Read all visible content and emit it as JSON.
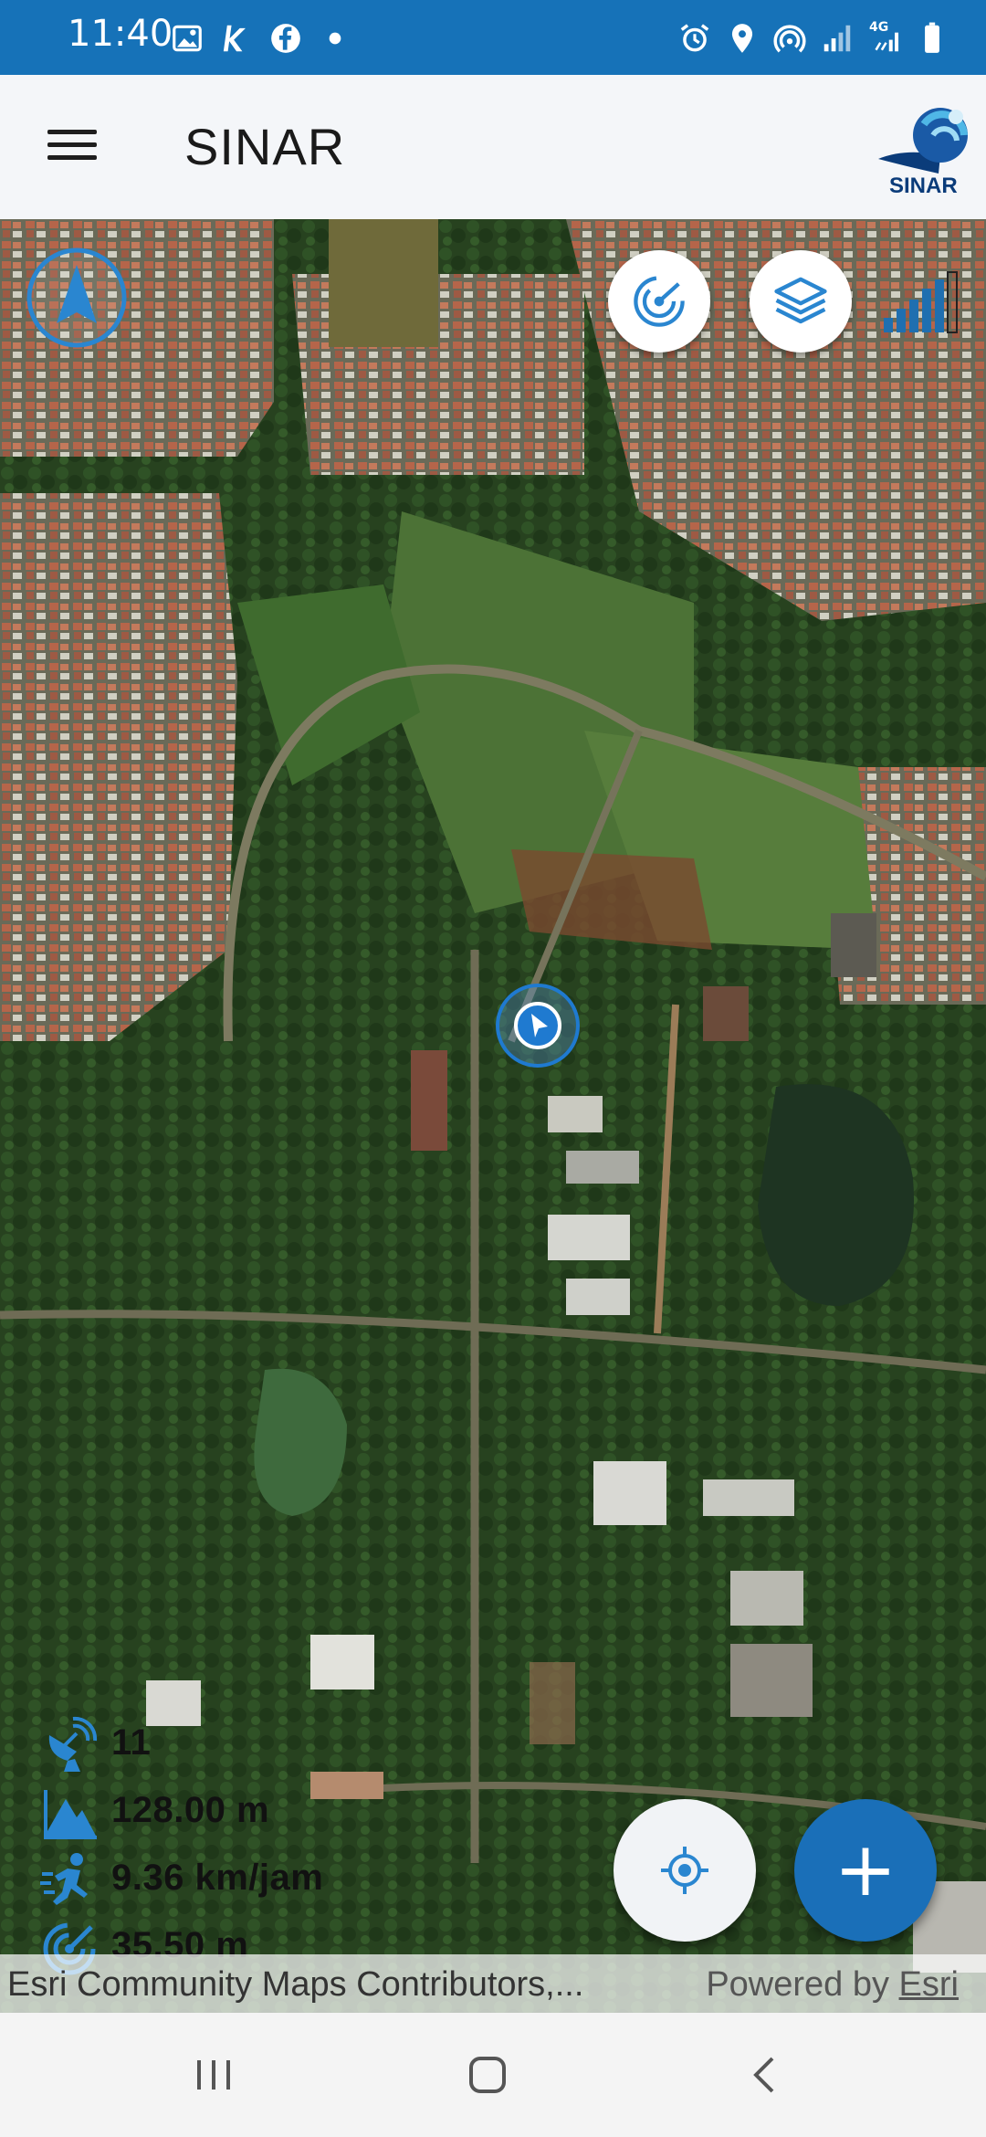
{
  "status_bar": {
    "time": "11:40",
    "left_icons": [
      "image-icon",
      "k-app-icon",
      "facebook-icon",
      "dot-icon"
    ],
    "right_icons": [
      "alarm-icon",
      "location-pin-icon",
      "hotspot-icon",
      "signal-icon",
      "4g-signal-icon",
      "battery-icon"
    ],
    "network_label": "4G"
  },
  "app_bar": {
    "title": "SINAR",
    "logo_text": "SINAR"
  },
  "map": {
    "controls": [
      "compass-icon",
      "radar-icon",
      "layers-icon",
      "gps-signal-icon"
    ],
    "stats": {
      "satellites": "11",
      "altitude": "128.00 m",
      "speed": "9.36 km/jam",
      "accuracy": "35.50 m"
    },
    "attribution": {
      "left": "Esri Community Maps Contributors,...",
      "powered_by": "Powered by",
      "esri": "Esri"
    },
    "add_label": "+"
  },
  "colors": {
    "primary": "#1672b8",
    "fab": "#1a6fb8",
    "accent_icon": "#2a86d0"
  }
}
